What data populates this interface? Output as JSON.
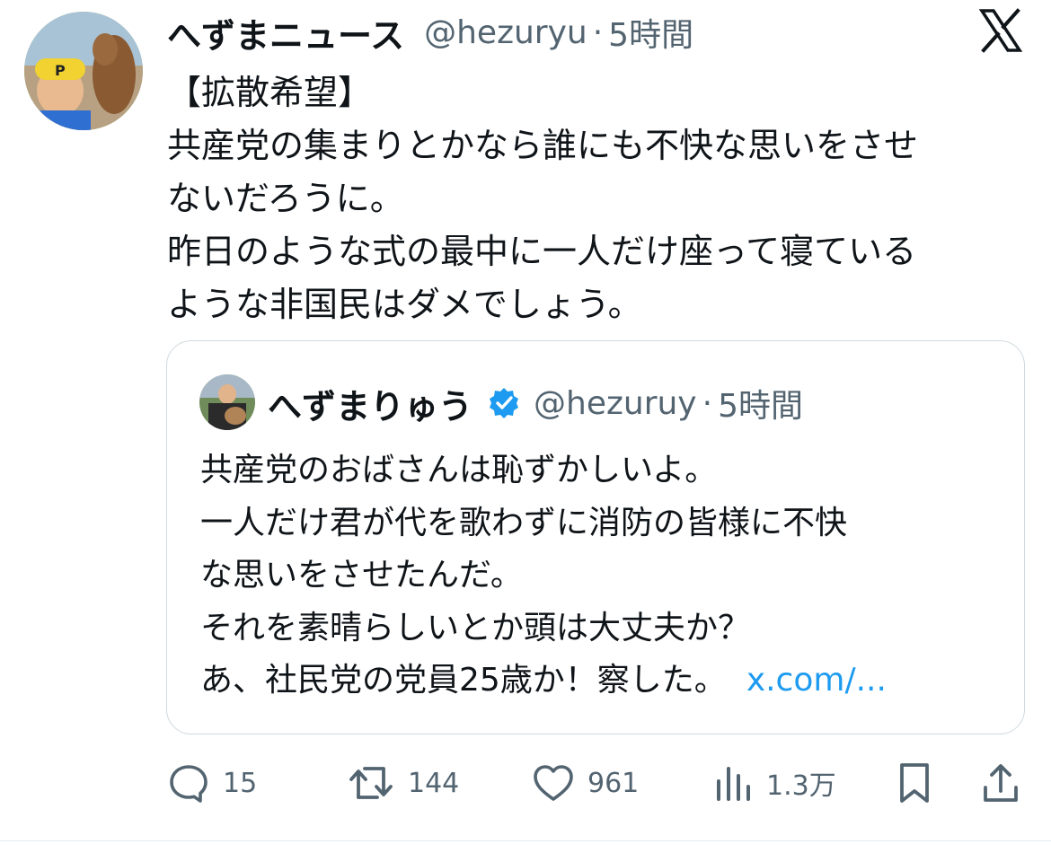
{
  "tweet": {
    "author": {
      "display_name": "へずまニュース",
      "handle": "@hezuryu",
      "dot": "·",
      "time": "5時間"
    },
    "text_lines": [
      "【拡散希望】",
      "共産党の集まりとかなら誰にも不快な思いをさせ",
      "ないだろうに。",
      "昨日のような式の最中に一人だけ座って寝ている",
      "ような非国民はダメでしょう。"
    ]
  },
  "quote": {
    "author": {
      "display_name": "へずまりゅう",
      "handle": "@hezuruy",
      "dot": "·",
      "time": "5時間",
      "verified": true
    },
    "text_lines": [
      "共産党のおばさんは恥ずかしいよ。",
      "一人だけ君が代を歌わずに消防の皆様に不快",
      "な思いをさせたんだ。",
      "それを素晴らしいとか頭は大丈夫か？",
      "あ、社民党の党員25歳か！察した。"
    ],
    "link": "x.com/..."
  },
  "actions": {
    "replies": "15",
    "reposts": "144",
    "likes": "961",
    "views": "1.3万"
  },
  "colors": {
    "text": "#0f1419",
    "secondary": "#536471",
    "link": "#1d9bf0",
    "border": "#cfd9de"
  }
}
